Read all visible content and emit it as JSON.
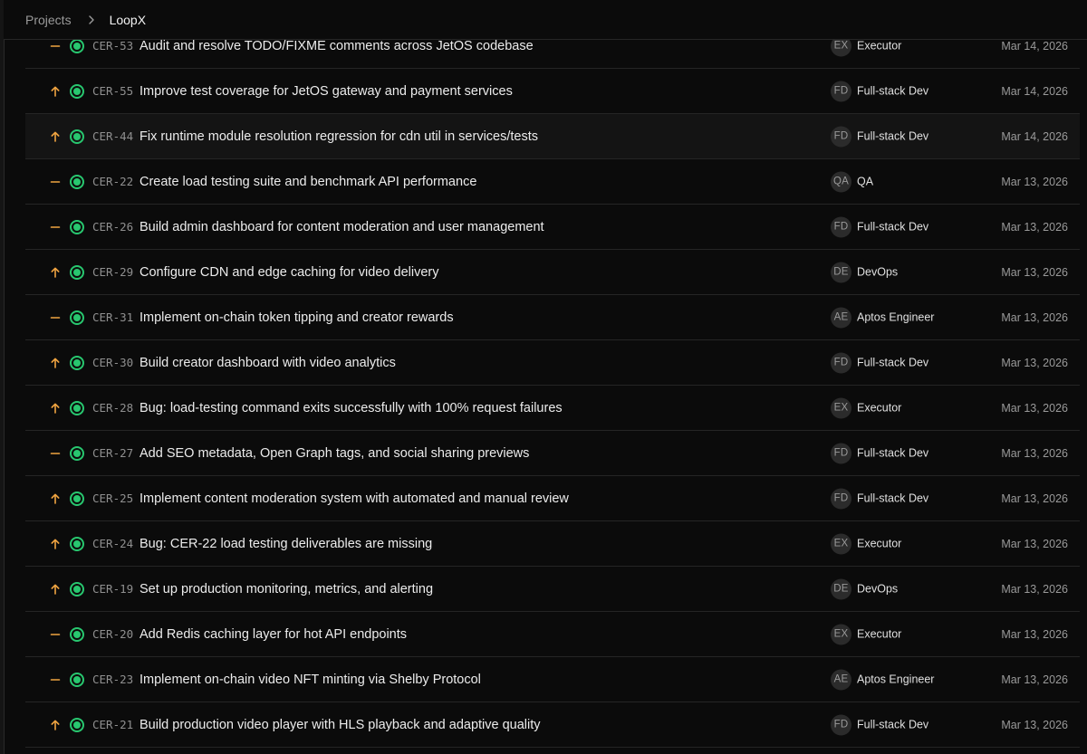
{
  "breadcrumb": {
    "parent": "Projects",
    "current": "LoopX"
  },
  "colors": {
    "priority_accent": "#f0a441",
    "status_done": "#28c76f",
    "background": "#0b0b0b"
  },
  "icons": {
    "separator": "chevron-right-icon",
    "priority_high": "arrow-up-icon",
    "priority_medium": "dash-icon",
    "status": "status-circle-icon"
  },
  "issues": [
    {
      "priority": "medium",
      "key": "CER-53",
      "title": "Audit and resolve TODO/FIXME comments across JetOS codebase",
      "assignee_initials": "EX",
      "assignee": "Executor",
      "date": "Mar 14, 2026"
    },
    {
      "priority": "high",
      "key": "CER-55",
      "title": "Improve test coverage for JetOS gateway and payment services",
      "assignee_initials": "FD",
      "assignee": "Full-stack Dev",
      "date": "Mar 14, 2026"
    },
    {
      "priority": "high",
      "key": "CER-44",
      "title": "Fix runtime module resolution regression for cdn util in services/tests",
      "assignee_initials": "FD",
      "assignee": "Full-stack Dev",
      "date": "Mar 14, 2026"
    },
    {
      "priority": "medium",
      "key": "CER-22",
      "title": "Create load testing suite and benchmark API performance",
      "assignee_initials": "QA",
      "assignee": "QA",
      "date": "Mar 13, 2026"
    },
    {
      "priority": "medium",
      "key": "CER-26",
      "title": "Build admin dashboard for content moderation and user management",
      "assignee_initials": "FD",
      "assignee": "Full-stack Dev",
      "date": "Mar 13, 2026"
    },
    {
      "priority": "high",
      "key": "CER-29",
      "title": "Configure CDN and edge caching for video delivery",
      "assignee_initials": "DE",
      "assignee": "DevOps",
      "date": "Mar 13, 2026"
    },
    {
      "priority": "medium",
      "key": "CER-31",
      "title": "Implement on-chain token tipping and creator rewards",
      "assignee_initials": "AE",
      "assignee": "Aptos Engineer",
      "date": "Mar 13, 2026"
    },
    {
      "priority": "high",
      "key": "CER-30",
      "title": "Build creator dashboard with video analytics",
      "assignee_initials": "FD",
      "assignee": "Full-stack Dev",
      "date": "Mar 13, 2026"
    },
    {
      "priority": "high",
      "key": "CER-28",
      "title": "Bug: load-testing command exits successfully with 100% request failures",
      "assignee_initials": "EX",
      "assignee": "Executor",
      "date": "Mar 13, 2026"
    },
    {
      "priority": "medium",
      "key": "CER-27",
      "title": "Add SEO metadata, Open Graph tags, and social sharing previews",
      "assignee_initials": "FD",
      "assignee": "Full-stack Dev",
      "date": "Mar 13, 2026"
    },
    {
      "priority": "high",
      "key": "CER-25",
      "title": "Implement content moderation system with automated and manual review",
      "assignee_initials": "FD",
      "assignee": "Full-stack Dev",
      "date": "Mar 13, 2026"
    },
    {
      "priority": "high",
      "key": "CER-24",
      "title": "Bug: CER-22 load testing deliverables are missing",
      "assignee_initials": "EX",
      "assignee": "Executor",
      "date": "Mar 13, 2026"
    },
    {
      "priority": "high",
      "key": "CER-19",
      "title": "Set up production monitoring, metrics, and alerting",
      "assignee_initials": "DE",
      "assignee": "DevOps",
      "date": "Mar 13, 2026"
    },
    {
      "priority": "medium",
      "key": "CER-20",
      "title": "Add Redis caching layer for hot API endpoints",
      "assignee_initials": "EX",
      "assignee": "Executor",
      "date": "Mar 13, 2026"
    },
    {
      "priority": "medium",
      "key": "CER-23",
      "title": "Implement on-chain video NFT minting via Shelby Protocol",
      "assignee_initials": "AE",
      "assignee": "Aptos Engineer",
      "date": "Mar 13, 2026"
    },
    {
      "priority": "high",
      "key": "CER-21",
      "title": "Build production video player with HLS playback and adaptive quality",
      "assignee_initials": "FD",
      "assignee": "Full-stack Dev",
      "date": "Mar 13, 2026"
    }
  ]
}
